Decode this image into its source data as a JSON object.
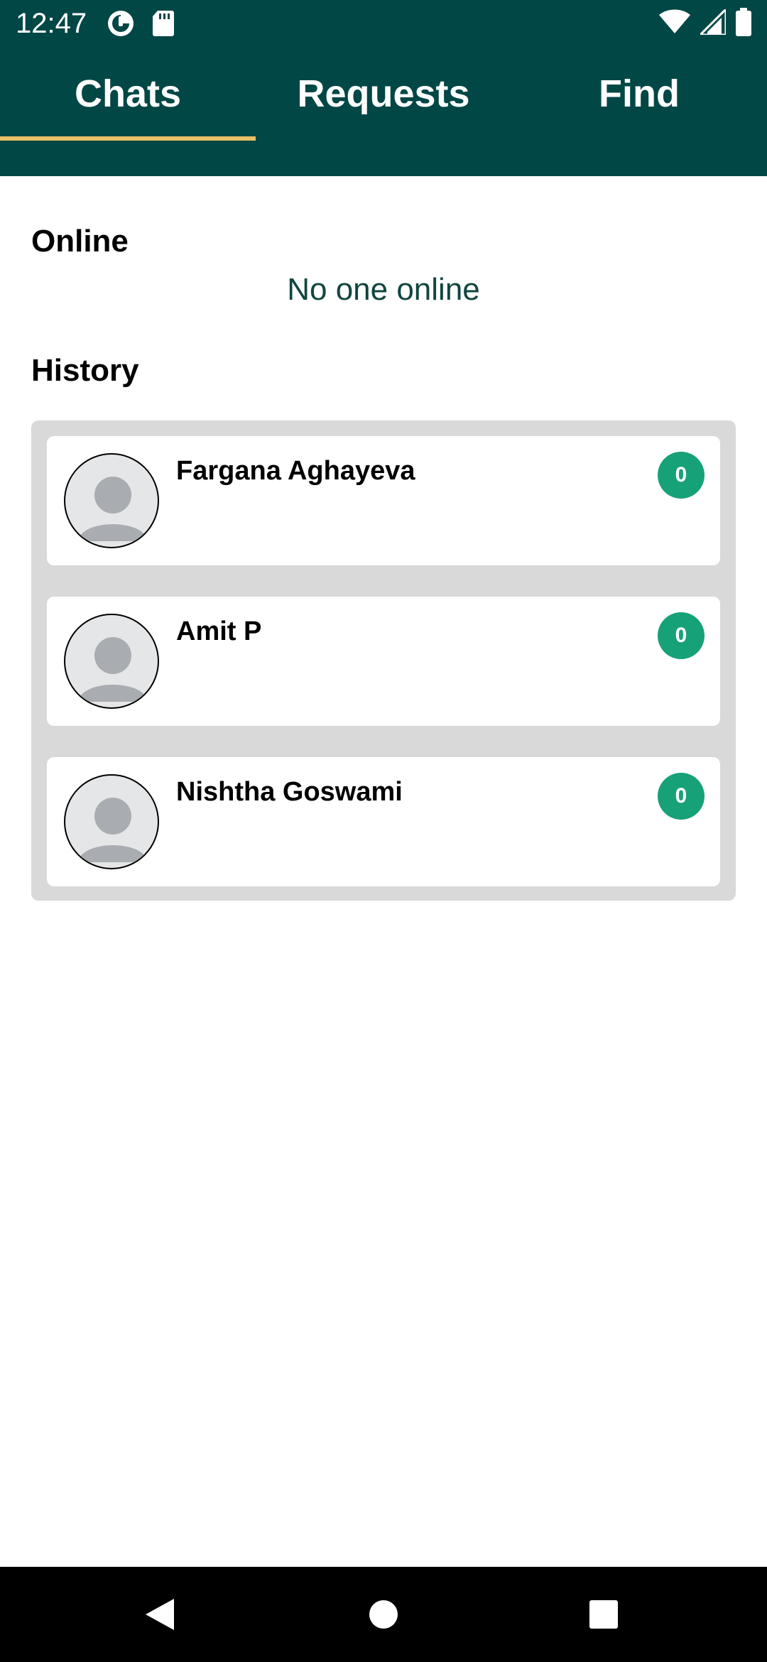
{
  "status_bar": {
    "time": "12:47",
    "icons_left": [
      "data-saver-icon",
      "sd-card-icon"
    ],
    "icons_right": [
      "wifi-icon",
      "cell-signal-icon",
      "battery-icon"
    ]
  },
  "tabs": [
    {
      "label": "Chats",
      "active": true
    },
    {
      "label": "Requests",
      "active": false
    },
    {
      "label": "Find",
      "active": false
    }
  ],
  "online": {
    "title": "Online",
    "empty_text": "No one online"
  },
  "history": {
    "title": "History",
    "chats": [
      {
        "name": "Fargana Aghayeva",
        "unread": "0",
        "avatar": "default-avatar-icon"
      },
      {
        "name": "Amit P",
        "unread": "0",
        "avatar": "default-avatar-icon"
      },
      {
        "name": "Nishtha Goswami",
        "unread": "0",
        "avatar": "default-avatar-icon"
      }
    ]
  },
  "nav_bar": {
    "buttons": [
      "back-icon",
      "home-icon",
      "recents-icon"
    ]
  },
  "colors": {
    "header_bg": "#014745",
    "tab_indicator": "#e8c167",
    "badge_bg": "#17a179",
    "panel_bg": "#d9d9d9",
    "empty_text": "#11463f"
  }
}
